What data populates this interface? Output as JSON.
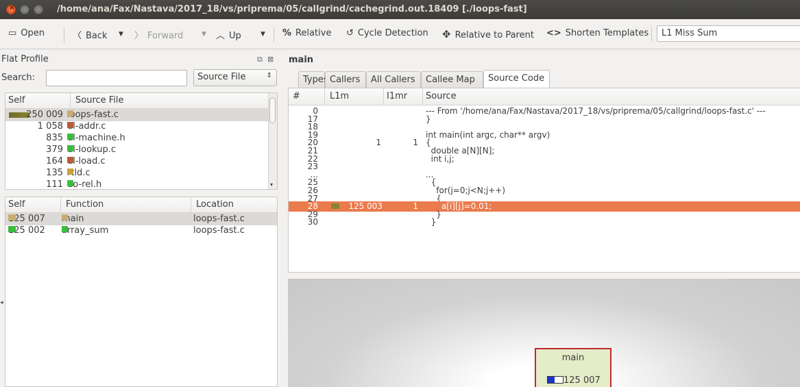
{
  "window": {
    "title": "/home/ana/Fax/Nastava/2017_18/vs/priprema/05/callgrind/cachegrind.out.18409 [./loops-fast]"
  },
  "toolbar": {
    "open": "Open",
    "back": "Back",
    "forward": "Forward",
    "up": "Up",
    "relative": "Relative",
    "cycle_detection": "Cycle Detection",
    "relative_to_parent": "Relative to Parent",
    "shorten_templates": "Shorten Templates",
    "cost_type": "L1 Miss Sum"
  },
  "flat_profile": {
    "title": "Flat Profile",
    "search_label": "Search:",
    "search_value": "",
    "group_by": "Source File",
    "files_header": {
      "self": "Self",
      "name": "Source File"
    },
    "files": [
      {
        "self": "250 009",
        "name": "loops-fast.c",
        "color": "#c9ac72",
        "selected": true
      },
      {
        "self": "1 058",
        "name": "dl-addr.c",
        "color": "#b85c3c"
      },
      {
        "self": "835",
        "name": "dl-machine.h",
        "color": "#3cbc3c"
      },
      {
        "self": "379",
        "name": "dl-lookup.c",
        "color": "#3cbc3c"
      },
      {
        "self": "164",
        "name": "dl-load.c",
        "color": "#b85c3c"
      },
      {
        "self": "135",
        "name": "rtld.c",
        "color": "#c8a23c"
      },
      {
        "self": "111",
        "name": "do-rel.h",
        "color": "#3cbc3c"
      }
    ],
    "functions_header": {
      "self": "Self",
      "name": "Function",
      "location": "Location"
    },
    "functions": [
      {
        "self": "125 007",
        "name": "main",
        "location": "loops-fast.c",
        "color": "#c9ac72",
        "selected": true
      },
      {
        "self": "125 002",
        "name": "array_sum",
        "location": "loops-fast.c",
        "color": "#3cbc3c"
      }
    ]
  },
  "detail": {
    "function_name": "main",
    "tabs": [
      "Types",
      "Callers",
      "All Callers",
      "Callee Map",
      "Source Code"
    ],
    "active_tab": "Source Code",
    "source_header": {
      "line": "#",
      "l1m": "L1m",
      "i1mr": "I1mr",
      "source": "Source"
    },
    "source_lines": [
      {
        "line": "0",
        "l1m": "",
        "i1mr": "",
        "text": "--- From '/home/ana/Fax/Nastava/2017_18/vs/priprema/05/callgrind/loops-fast.c' ---"
      },
      {
        "line": "17",
        "l1m": "",
        "i1mr": "",
        "text": "}"
      },
      {
        "line": "18",
        "l1m": "",
        "i1mr": "",
        "text": ""
      },
      {
        "line": "19",
        "l1m": "",
        "i1mr": "",
        "text": "int main(int argc, char** argv)"
      },
      {
        "line": "20",
        "l1m": "1",
        "i1mr": "1",
        "text": "{"
      },
      {
        "line": "21",
        "l1m": "",
        "i1mr": "",
        "text": "  double a[N][N];"
      },
      {
        "line": "22",
        "l1m": "",
        "i1mr": "",
        "text": "  int i,j;"
      },
      {
        "line": "23",
        "l1m": "",
        "i1mr": "",
        "text": ""
      },
      {
        "line": "...",
        "l1m": "",
        "i1mr": "",
        "text": "..."
      },
      {
        "line": "25",
        "l1m": "",
        "i1mr": "",
        "text": "  {"
      },
      {
        "line": "26",
        "l1m": "",
        "i1mr": "",
        "text": "    for(j=0;j<N;j++)"
      },
      {
        "line": "27",
        "l1m": "",
        "i1mr": "",
        "text": "    {"
      },
      {
        "line": "28",
        "l1m": "125 003",
        "i1mr": "1",
        "text": "      a[i][j]=0.01;",
        "highlight": true
      },
      {
        "line": "29",
        "l1m": "",
        "i1mr": "",
        "text": "    }"
      },
      {
        "line": "30",
        "l1m": "",
        "i1mr": "",
        "text": "  }"
      }
    ]
  },
  "call_graph": {
    "node_name": "main",
    "node_cost": "125 007"
  },
  "colors": {
    "highlight": "#ea7b4d",
    "node_border": "#c2272d",
    "node_fill": "#e4ecc8"
  }
}
